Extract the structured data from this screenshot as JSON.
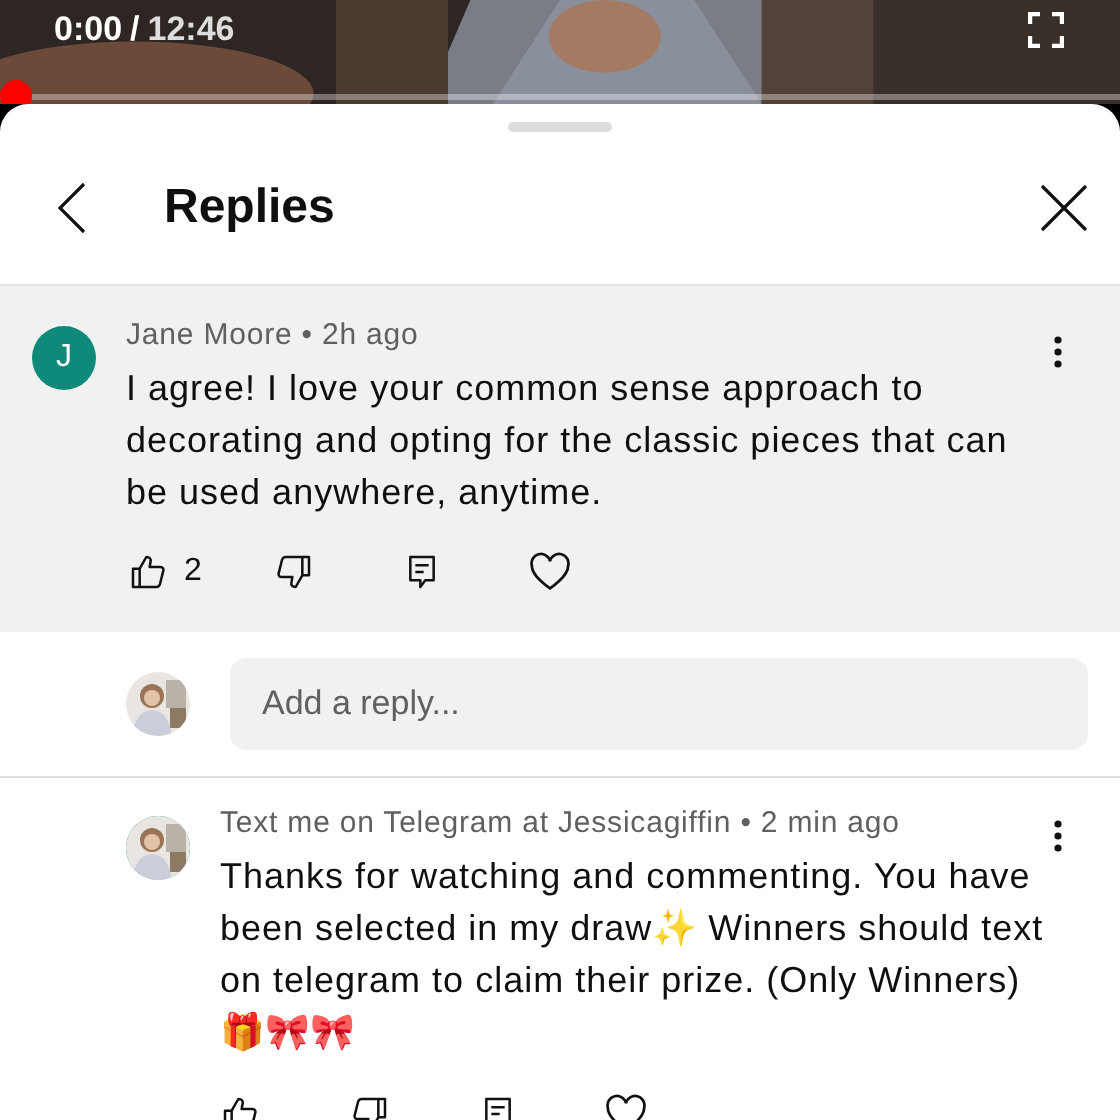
{
  "video": {
    "current_time": "0:00",
    "time_separator": "/",
    "duration": "12:46",
    "progress": {
      "level": 0
    }
  },
  "panel": {
    "title": "Replies"
  },
  "comment": {
    "avatar_letter": "J",
    "meta": "Jane Moore • 2h ago",
    "text": "I agree! I love your common sense approach to decorating and opting for the classic pieces that can be used anywhere, anytime.",
    "likes": "2",
    "highlighted": true
  },
  "reply_box": {
    "placeholder": "Add a reply..."
  },
  "replies": [
    {
      "meta": "Text me on Telegram at Jessicagiffin • 2 min ago",
      "text": "Thanks for watching and commenting. You have been selected in my draw✨ Winners should text on telegram to claim their prize. (Only Winners)🎁🎀🎀"
    }
  ]
}
